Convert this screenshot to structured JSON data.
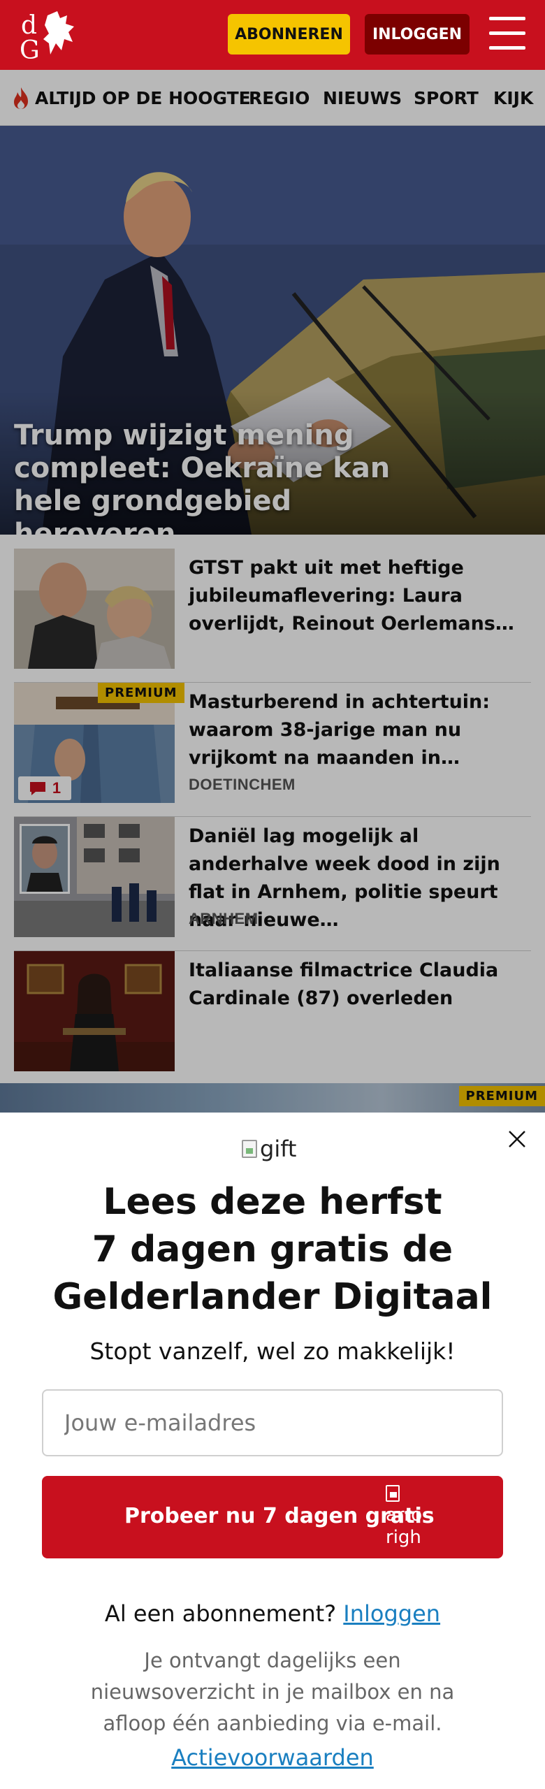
{
  "header": {
    "subscribe_label": "ABONNEREN",
    "login_label": "INLOGGEN"
  },
  "nav": {
    "items": [
      "ALTIJD OP DE HOOGTE",
      "REGIO",
      "NIEUWS",
      "SPORT",
      "KIJK"
    ]
  },
  "hero": {
    "title": "Trump wijzigt mening compleet: Oekraïne kan hele grondgebied heroveren"
  },
  "articles": [
    {
      "title": "GTST pakt uit met heftige jubileumaflevering: Laura overlijdt, Reinout Oerlemans…",
      "location": "",
      "premium": false,
      "comments": null
    },
    {
      "title": "Masturberend in achtertuin: waarom 38-jarige man nu vrijkomt na maanden in…",
      "location": "DOETINCHEM",
      "premium": true,
      "premium_label": "PREMIUM",
      "comments": "1"
    },
    {
      "title": "Daniël lag mogelijk al anderhalve week dood in zijn flat in Arnhem, politie speurt naar nieuwe…",
      "location": "ARNHEM",
      "premium": false,
      "comments": null
    },
    {
      "title": "Italiaanse filmactrice Claudia Cardinale (87) overleden",
      "location": "",
      "premium": false,
      "comments": null
    }
  ],
  "next_strip": {
    "premium_label": "PREMIUM"
  },
  "modal": {
    "gift_alt": "gift",
    "title_lines": [
      "Lees deze herfst",
      "7 dagen gratis de",
      "Gelderlander Digitaal"
    ],
    "subtitle": "Stopt vanzelf, wel zo makkelijk!",
    "email_placeholder": "Jouw e-mailadres",
    "cta_label": "Probeer nu 7 dagen gratis",
    "cta_arrow_alt_lines": [
      "arro",
      "righ"
    ],
    "login_prompt": "Al een abonnement?",
    "login_link": "Inloggen",
    "info_lines": [
      "Je ontvangt dagelijks een",
      "nieuwsoverzicht in je mailbox en na",
      "afloop één aanbieding via e-mail."
    ],
    "terms_link": "Actievoorwaarden"
  },
  "colors": {
    "brand_red": "#c8101e",
    "dark_red": "#7c0000",
    "premium_yellow": "#f5c400",
    "link_blue": "#1a7fc0"
  }
}
